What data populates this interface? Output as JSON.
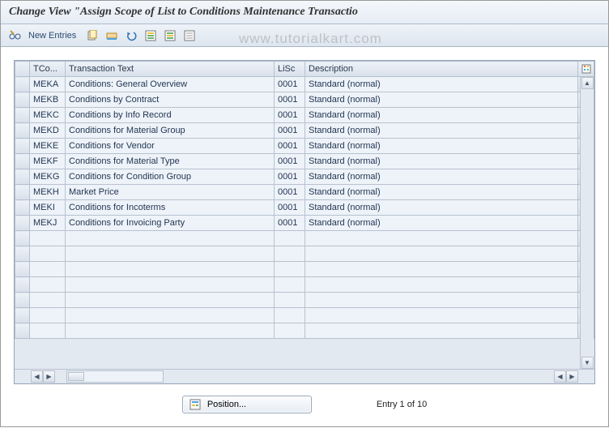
{
  "title": "Change View \"Assign Scope of List to Conditions Maintenance Transactio",
  "watermark": "www.tutorialkart.com",
  "toolbar": {
    "new_entries_label": "New Entries"
  },
  "columns": {
    "tco": "TCo...",
    "txt": "Transaction Text",
    "lisc": "LiSc",
    "desc": "Description"
  },
  "rows": [
    {
      "tco": "MEKA",
      "txt": "Conditions: General Overview",
      "lisc": "0001",
      "desc": "Standard (normal)"
    },
    {
      "tco": "MEKB",
      "txt": "Conditions by Contract",
      "lisc": "0001",
      "desc": "Standard (normal)"
    },
    {
      "tco": "MEKC",
      "txt": "Conditions by Info Record",
      "lisc": "0001",
      "desc": "Standard (normal)"
    },
    {
      "tco": "MEKD",
      "txt": "Conditions for Material Group",
      "lisc": "0001",
      "desc": "Standard (normal)"
    },
    {
      "tco": "MEKE",
      "txt": "Conditions for Vendor",
      "lisc": "0001",
      "desc": "Standard (normal)"
    },
    {
      "tco": "MEKF",
      "txt": "Conditions for Material Type",
      "lisc": "0001",
      "desc": "Standard (normal)"
    },
    {
      "tco": "MEKG",
      "txt": "Conditions for Condition Group",
      "lisc": "0001",
      "desc": "Standard (normal)"
    },
    {
      "tco": "MEKH",
      "txt": "Market Price",
      "lisc": "0001",
      "desc": "Standard (normal)"
    },
    {
      "tco": "MEKI",
      "txt": "Conditions for Incoterms",
      "lisc": "0001",
      "desc": "Standard (normal)"
    },
    {
      "tco": "MEKJ",
      "txt": "Conditions for Invoicing Party",
      "lisc": "0001",
      "desc": "Standard (normal)"
    }
  ],
  "empty_rows": 7,
  "footer": {
    "position_label": "Position...",
    "entry_label": "Entry 1 of 10"
  },
  "icons": {
    "toggle": "toggle-icon",
    "copy": "copy-icon",
    "delete": "delete-icon",
    "undo": "undo-icon",
    "select_all": "select-all-icon",
    "select_block": "select-block-icon",
    "deselect_all": "deselect-all-icon",
    "config": "config-icon"
  },
  "colors": {
    "header_bg": "#e6ecf4",
    "row_bg": "#eef3f9",
    "border": "#b7c1cf"
  }
}
